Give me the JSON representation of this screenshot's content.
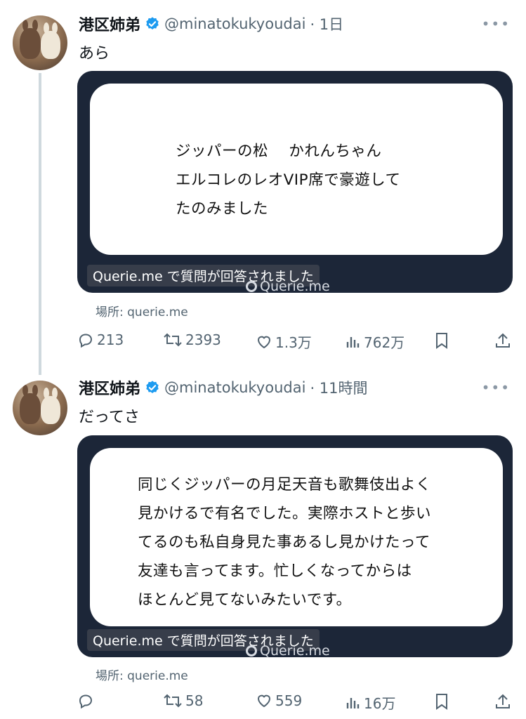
{
  "tweets": [
    {
      "name": "港区姉弟",
      "handle": "@minatokukyoudai",
      "time": "· 1日",
      "text": "あら",
      "answer_lines": [
        "ジッパーの松　 かれんちゃん",
        "エルコレのレオVIP席で豪遊して",
        "たのみました"
      ],
      "caption": "Querie.me で質問が回答されました",
      "watermark": "Querie.me",
      "place": "場所: querie.me",
      "replies": "213",
      "retweets": "2393",
      "likes": "1.3万",
      "views": "762万"
    },
    {
      "name": "港区姉弟",
      "handle": "@minatokukyoudai",
      "time": "· 11時間",
      "text": "だってさ",
      "answer_lines": [
        "同じくジッパーの月足天音も歌舞伎出よく",
        "見かけるで有名でした。実際ホストと歩い",
        "てるのも私自身見た事あるし見かけたって",
        "友達も言ってます。忙しくなってからは",
        "ほとんど見てないみたいです。"
      ],
      "caption": "Querie.me で質問が回答されました",
      "watermark": "Querie.me",
      "place": "場所: querie.me",
      "replies": "",
      "retweets": "58",
      "likes": "559",
      "views": "16万"
    }
  ],
  "colors": {
    "verified": "#1d9bf0",
    "card_bg": "#1c2638",
    "muted": "#536471"
  },
  "icons": [
    "reply-icon",
    "retweet-icon",
    "like-icon",
    "views-icon",
    "bookmark-icon",
    "share-icon",
    "verified-badge-icon",
    "more-icon"
  ]
}
